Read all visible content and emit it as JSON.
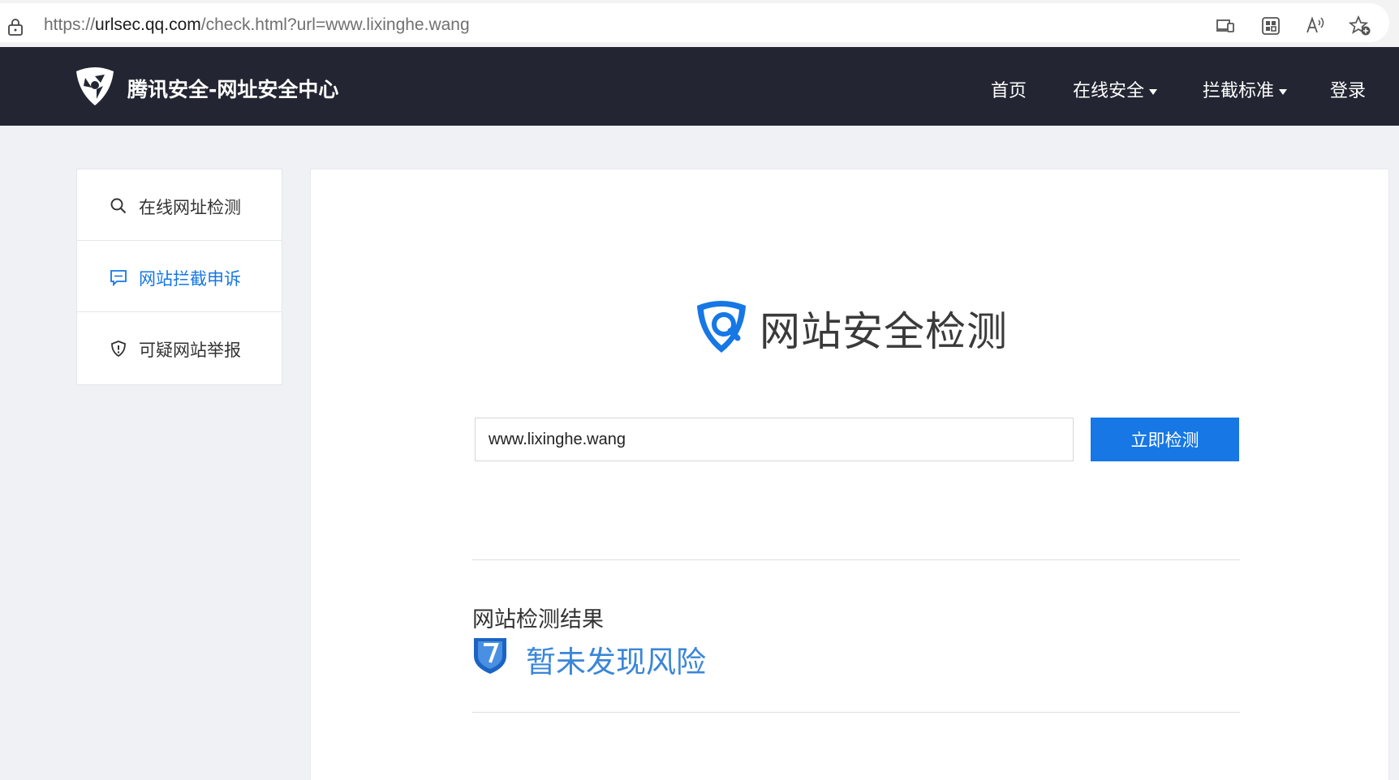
{
  "browser": {
    "url_prefix": "https://",
    "url_host": "urlsec.qq.com",
    "url_path": "/check.html?url=www.lixinghe.wang"
  },
  "header": {
    "site_title": "腾讯安全-网址安全中心",
    "nav": [
      {
        "label": "首页",
        "has_dropdown": false
      },
      {
        "label": "在线安全",
        "has_dropdown": true
      },
      {
        "label": "拦截标准",
        "has_dropdown": true
      },
      {
        "label": "登录",
        "has_dropdown": false
      }
    ]
  },
  "sidebar": {
    "items": [
      {
        "label": "在线网址检测",
        "icon": "search-icon",
        "active": false
      },
      {
        "label": "网站拦截申诉",
        "icon": "message-icon",
        "active": true
      },
      {
        "label": "可疑网站举报",
        "icon": "shield-alert-icon",
        "active": false
      }
    ]
  },
  "main": {
    "hero_title": "网站安全检测",
    "search": {
      "value": "www.lixinghe.wang",
      "button_label": "立即检测"
    },
    "result": {
      "heading": "网站检测结果",
      "status_text": "暂未发现风险",
      "status_color": "#3a86d8"
    }
  },
  "colors": {
    "header_bg": "#232632",
    "accent": "#1677e5",
    "page_bg": "#f0f1f5"
  }
}
